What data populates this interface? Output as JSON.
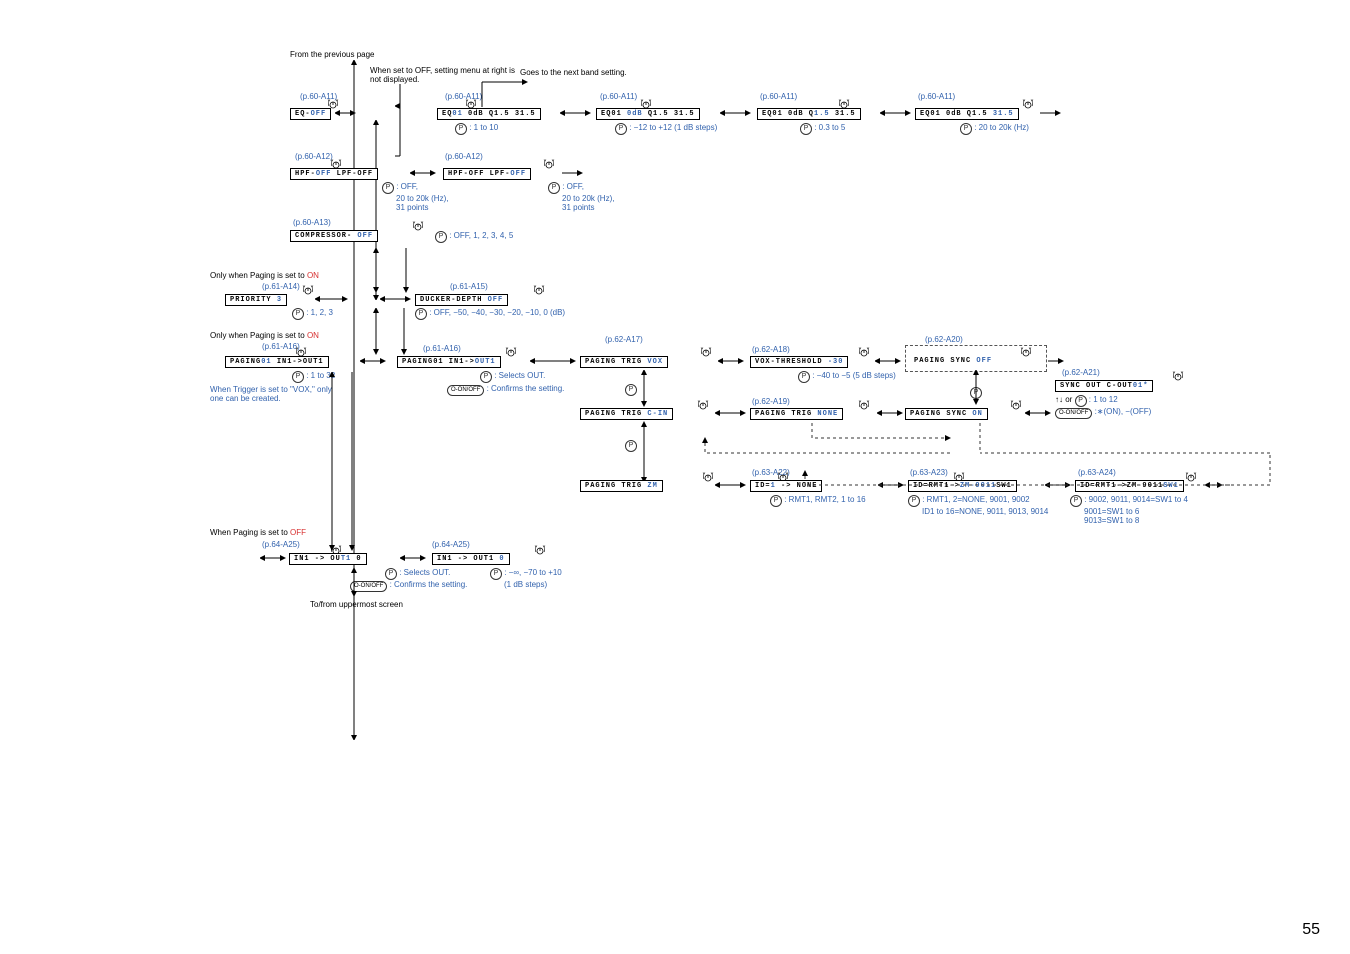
{
  "page_number": "55",
  "header": {
    "from_previous": "From the previous page",
    "note_off": "When set to OFF, setting menu at right is not displayed.",
    "goes_next": "Goes to the next band setting."
  },
  "eq_row": {
    "ref1": "(p.60-A11)",
    "box1_a": "EQ-",
    "box1_b": "OFF",
    "ref2": "(p.60-A11)",
    "box2_a": "EQ",
    "box2_b": "01",
    "box2_c": " 0dB  Q1.5  31.5",
    "p1": ": 1 to 10",
    "ref3": "(p.60-A11)",
    "box3_a": "EQ01 ",
    "box3_b": "0dB",
    "box3_c": "  Q1.5  31.5",
    "p2": ": −12 to +12 (1 dB steps)",
    "ref4": "(p.60-A11)",
    "box4_a": "EQ01 0dB  Q",
    "box4_b": "1.5",
    "box4_c": "  31.5",
    "p3": ": 0.3 to 5",
    "ref5": "(p.60-A11)",
    "box5_a": "EQ01 0dB  Q1.5  ",
    "box5_b": "31.5",
    "p4": ": 20 to 20k (Hz)"
  },
  "hpf_row": {
    "ref1": "(p.60-A12)",
    "box1_a": "HPF-",
    "box1_b": "OFF",
    "box1_c": "   LPF-OFF",
    "ref2": "(p.60-A12)",
    "box2_a": "HPF-OFF   LPF-",
    "box2_b": "OFF",
    "p1a": ": OFF,",
    "p1b": "20 to 20k (Hz),",
    "p1c": "31 points",
    "p2a": ": OFF,",
    "p2b": "20 to 20k (Hz),",
    "p2c": "31 points"
  },
  "comp_row": {
    "ref": "(p.60-A13)",
    "box_a": "COMPRESSOR-      ",
    "box_b": "OFF",
    "p": ": OFF, 1, 2, 3, 4, 5"
  },
  "priority_row": {
    "note": "Only when Paging is set to ",
    "note_on": "ON",
    "ref1": "(p.61-A14)",
    "box1_a": "PRIORITY ",
    "box1_b": "3",
    "p1": ": 1, 2, 3",
    "ref2": "(p.61-A15)",
    "box2_a": "DUCKER-DEPTH   ",
    "box2_b": "OFF",
    "p2": ": OFF, −50, −40, −30, −20, −10, 0 (dB)"
  },
  "paging_section": {
    "note": "Only when Paging is set to ",
    "note_on": "ON",
    "ref_a16": "(p.61-A16)",
    "box_a16_a": "PAGING",
    "box_a16_b": "01",
    "box_a16_c": "  IN1->OUT1",
    "p_a16": ": 1 to 32",
    "trigger_note": "When Trigger is set to \"VOX,\" only one can be created.",
    "ref_a16b": "(p.61-A16)",
    "box_a16b_a": "PAGING01  IN1->",
    "box_a16b_b": "OUT1",
    "p_a16b_a": ": Selects OUT.",
    "p_a16b_b": ": Confirms the setting.",
    "ref_a17": "(p.62-A17)",
    "box_a17_a": "PAGING TRIG     ",
    "box_a17_b": "VOX",
    "ref_a18": "(p.62-A18)",
    "box_a18_a": "VOX-THRESHOLD ",
    "box_a18_b": "-30",
    "p_a18": ": −40 to −5 (5 dB steps)",
    "ref_a19": "(p.62-A19)",
    "box_a19_a": "PAGING TRIG   ",
    "box_a19_b": "C-IN",
    "box_a19c_a": "PAGING TRIG   ",
    "box_a19c_b": "NONE",
    "ref_a20": "(p.62-A20)",
    "box_a20_a": "PAGING SYNC    ",
    "box_a20_b": "OFF",
    "box_a20b_a": "PAGING SYNC     ",
    "box_a20b_b": "ON",
    "ref_a21": "(p.62-A21)",
    "box_a21_a": "SYNC OUT   C-OUT",
    "box_a21_b": "01*",
    "p_a21_a": "↑↓ or ",
    "p_a21_b": " : 1 to 12",
    "p_a21_c": " :∗(ON), −(OFF)",
    "ref_a22": "(p.63-A22)",
    "box_a22_a": "PAGING TRIG     ",
    "box_a22_b": "ZM",
    "box_a22b_a": "ID=",
    "box_a22b_b": "1",
    "box_a22b_c": "     ->    NONE",
    "p_a22": ": RMT1, RMT2, 1 to 16",
    "ref_a23": "(p.63-A23)",
    "box_a23_a": "ID=RMT1->",
    "box_a23_b": "ZM-9011",
    "box_a23_c": "SW1",
    "p_a23_a": ": RMT1, 2=NONE, 9001, 9002",
    "p_a23_b": "ID1 to 16=NONE, 9011, 9013, 9014",
    "ref_a24": "(p.63-A24)",
    "box_a24_a": "ID=RMT1->ZM-9011",
    "box_a24_b": "SW1",
    "p_a24_a": ": 9002, 9011, 9014=SW1 to 4",
    "p_a24_b": "9001=SW1 to 6",
    "p_a24_c": "9013=SW1 to 8"
  },
  "out_section": {
    "note": "When Paging is set to ",
    "note_off": "OFF",
    "ref": "(p.64-A25)",
    "box1_a": "IN1    ->   OU",
    "box1_b": "T1",
    "box1_c": "   0",
    "ref2": "(p.64-A25)",
    "box2_a": "IN1    ->   OUT1   ",
    "box2_b": "0",
    "p1": ": Selects OUT.",
    "p2": ": Confirms the setting.",
    "p3": ": −∞, −70 to +10",
    "p4": "(1 dB steps)"
  },
  "footer": {
    "to_from": "To/from uppermost screen"
  }
}
